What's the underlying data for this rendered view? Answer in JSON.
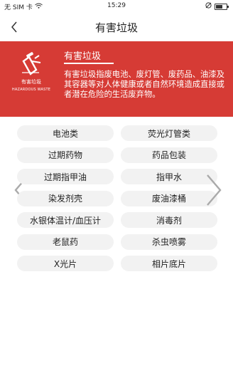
{
  "status_bar": {
    "carrier": "无 SIM 卡",
    "time": "15:29"
  },
  "nav": {
    "title": "有害垃圾"
  },
  "banner": {
    "background_color": "#d63b35",
    "logo_text_cn": "有害垃圾",
    "logo_text_en": "HAZARDOUS WASTE",
    "title": "有害垃圾",
    "description": "有害垃圾指废电池、废灯管、废药品、油漆及其容器等对人体健康或者自然环境造成直接或者潜在危险的生活废弃物。"
  },
  "items": [
    "电池类",
    "荧光灯管类",
    "过期药物",
    "药品包装",
    "过期指甲油",
    "指甲水",
    "染发剂壳",
    "废油漆桶",
    "水银体温计/血压计",
    "消毒剂",
    "老鼠药",
    "杀虫喷雾",
    "X光片",
    "相片底片"
  ]
}
